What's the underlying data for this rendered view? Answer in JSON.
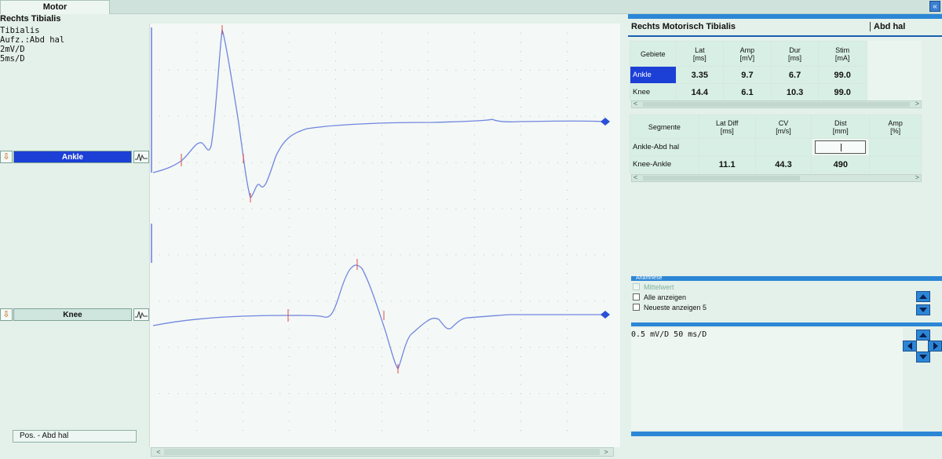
{
  "tab": {
    "label": "Motor"
  },
  "collapse_label": "«",
  "left": {
    "title": "Rechts Tibialis",
    "lines": [
      "Tibialis",
      "Aufz.:Abd hal",
      "2mV/D",
      "5ms/D"
    ],
    "traces": [
      {
        "arrow": "⇩",
        "label": "Ankle"
      },
      {
        "arrow": "⇩",
        "label": "Knee"
      }
    ],
    "pos_label": "Pos. - Abd hal"
  },
  "right": {
    "header": "Rechts Motorisch Tibialis",
    "header_right": "Abd hal",
    "gebiete": {
      "headers": [
        "Gebiete",
        "Lat\n[ms]",
        "Amp\n[mV]",
        "Dur\n[ms]",
        "Stim\n[mA]"
      ],
      "rows": [
        {
          "label": "Ankle",
          "lat": "3.35",
          "amp": "9.7",
          "dur": "6.7",
          "stim": "99.0"
        },
        {
          "label": "Knee",
          "lat": "14.4",
          "amp": "6.1",
          "dur": "10.3",
          "stim": "99.0"
        }
      ]
    },
    "segmente": {
      "headers": [
        "Segmente",
        "Lat Diff\n[ms]",
        "CV\n[m/s]",
        "Dist\n[mm]",
        "Amp\n[%]"
      ],
      "rows": [
        {
          "label": "Ankle-Abd hal",
          "latdiff": "",
          "cv": "",
          "dist": "",
          "amp": ""
        },
        {
          "label": "Knee-Ankle",
          "latdiff": "11.1",
          "cv": "44.3",
          "dist": "490",
          "amp": ""
        }
      ]
    },
    "anamnese": {
      "title": "Anamnese",
      "options": [
        "Mittelwert",
        "Alle anzeigen",
        "Neueste anzeigen 5"
      ]
    },
    "scale_text": "0.5 mV/D 50 ms/D"
  },
  "colors": {
    "trace": "#6f86e0",
    "marker": "#e04a4a",
    "end_marker": "#2a4fd8",
    "accent_blue": "#2c86d6",
    "selected": "#1c3fd6"
  }
}
